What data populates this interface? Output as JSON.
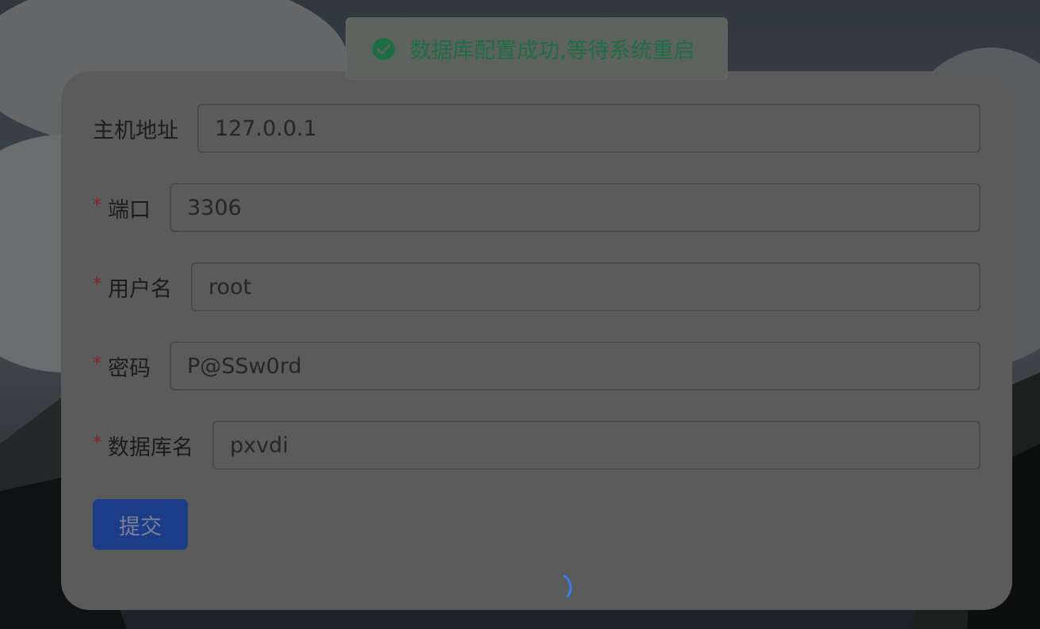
{
  "form": {
    "fields": [
      {
        "label": "主机地址",
        "required": false,
        "value": "127.0.0.1"
      },
      {
        "label": "端口",
        "required": true,
        "value": "3306"
      },
      {
        "label": "用户名",
        "required": true,
        "value": "root"
      },
      {
        "label": "密码",
        "required": true,
        "value": "P@SSw0rd"
      },
      {
        "label": "数据库名",
        "required": true,
        "value": "pxvdi"
      }
    ],
    "required_mark": "*",
    "submit_label": "提交"
  },
  "toast": {
    "icon": "check-circle-icon",
    "message": "数据库配置成功,等待系统重启",
    "color": "#1e6e44"
  },
  "loading": {
    "icon": "spinner-icon",
    "color": "#3a7bf0"
  },
  "colors": {
    "primary": "#1d3c87",
    "required": "#8b1e1e"
  }
}
